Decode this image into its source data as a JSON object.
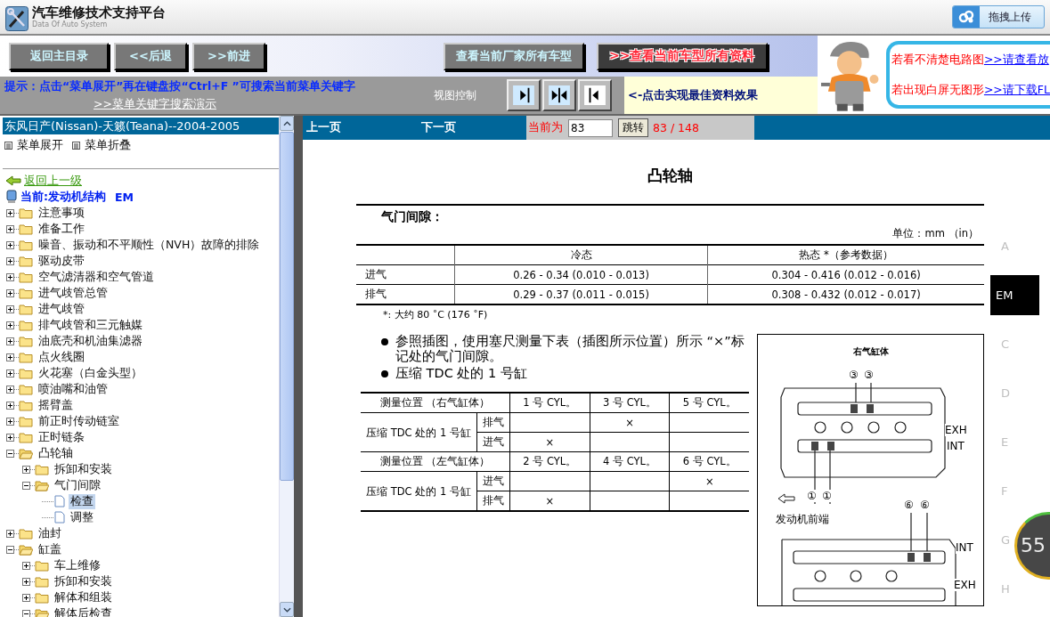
{
  "header": {
    "title": "汽车维修技术支持平台",
    "subtitle": "Data Of Auto System",
    "upload_button": "拖拽上传"
  },
  "toolbar": {
    "buttons": [
      {
        "label": "返回主目录",
        "kind": "plain"
      },
      {
        "label": "<<后退",
        "kind": "plain"
      },
      {
        "label": ">>前进",
        "kind": "plain"
      }
    ],
    "model_buttons": [
      {
        "label": "查看当前厂家所有车型",
        "kind": "plain"
      },
      {
        "label": ">>查看当前车型所有资料",
        "kind": "accent"
      }
    ]
  },
  "hint": {
    "text": "提示：点击“菜单展开”再在键盘按“Ctrl+F ”可搜索当前菜单关键字",
    "link": ">>菜单关键字搜索演示"
  },
  "view_control": {
    "label": "视图控制",
    "tip": "<-点击实现最佳资料效果"
  },
  "notice": {
    "lines": [
      {
        "text": "若看不清楚电路图",
        "link": ">>请查看放"
      },
      {
        "text": "若出现白屏无图形",
        "link": ">>请下载FL"
      }
    ]
  },
  "sidebar": {
    "vehicle": "东风日产(Nissan)-天籁(Teana)--2004-2005",
    "expand_all": "菜单展开",
    "collapse_all": "菜单折叠",
    "back_link": "返回上一级",
    "current": "当前:发动机结构",
    "current_code": "EM",
    "tree": [
      {
        "label": "注意事项",
        "kind": "folder",
        "expanded": false,
        "selected": false
      },
      {
        "label": "准备工作",
        "kind": "folder",
        "expanded": false,
        "selected": false
      },
      {
        "label": "噪音、振动和不平顺性（NVH）故障的排除",
        "kind": "folder",
        "expanded": false,
        "selected": false
      },
      {
        "label": "驱动皮带",
        "kind": "folder",
        "expanded": false,
        "selected": false
      },
      {
        "label": "空气滤清器和空气管道",
        "kind": "folder",
        "expanded": false,
        "selected": false
      },
      {
        "label": "进气歧管总管",
        "kind": "folder",
        "expanded": false,
        "selected": false
      },
      {
        "label": "进气歧管",
        "kind": "folder",
        "expanded": false,
        "selected": false
      },
      {
        "label": "排气歧管和三元触媒",
        "kind": "folder",
        "expanded": false,
        "selected": false
      },
      {
        "label": "油底壳和机油集滤器",
        "kind": "folder",
        "expanded": false,
        "selected": false
      },
      {
        "label": "点火线圈",
        "kind": "folder",
        "expanded": false,
        "selected": false
      },
      {
        "label": "火花塞（白金头型）",
        "kind": "folder",
        "expanded": false,
        "selected": false
      },
      {
        "label": "喷油嘴和油管",
        "kind": "folder",
        "expanded": false,
        "selected": false
      },
      {
        "label": "摇臂盖",
        "kind": "folder",
        "expanded": false,
        "selected": false
      },
      {
        "label": "前正时传动链室",
        "kind": "folder",
        "expanded": false,
        "selected": false
      },
      {
        "label": "正时链条",
        "kind": "folder",
        "expanded": false,
        "selected": false
      },
      {
        "label": "凸轮轴",
        "kind": "folder",
        "expanded": true,
        "selected": false,
        "children": [
          {
            "label": "拆卸和安装",
            "kind": "folder",
            "expanded": false,
            "selected": false
          },
          {
            "label": "气门间隙",
            "kind": "folder",
            "expanded": true,
            "selected": false,
            "children": [
              {
                "label": "检查",
                "kind": "page",
                "selected": true
              },
              {
                "label": "调整",
                "kind": "page",
                "selected": false
              }
            ]
          }
        ]
      },
      {
        "label": "油封",
        "kind": "folder",
        "expanded": false,
        "selected": false
      },
      {
        "label": "缸盖",
        "kind": "folder",
        "expanded": true,
        "selected": false,
        "children": [
          {
            "label": "车上维修",
            "kind": "folder",
            "expanded": false,
            "selected": false
          },
          {
            "label": "拆卸和安装",
            "kind": "folder",
            "expanded": false,
            "selected": false
          },
          {
            "label": "解体和组装",
            "kind": "folder",
            "expanded": false,
            "selected": false
          },
          {
            "label": "解体后检查",
            "kind": "folder",
            "expanded": true,
            "selected": false
          }
        ]
      }
    ]
  },
  "pager": {
    "prev": "上一页",
    "next": "下一页",
    "current_label": "当前为",
    "page_input": "83",
    "go_button": "跳转",
    "page_count": "83 / 148"
  },
  "document": {
    "title": "凸轮轴",
    "section": "气门间隙：",
    "unit": "单位：mm （in）",
    "clearance_table": {
      "columns": [
        "冷态",
        "热态 *（参考数据）"
      ],
      "rows": [
        {
          "valve": "进气",
          "cells": [
            "0.26 - 0.34 (0.010 - 0.013)",
            "0.304 - 0.416 (0.012 - 0.016)"
          ]
        },
        {
          "valve": "排气",
          "cells": [
            "0.29 - 0.37 (0.011 - 0.015)",
            "0.308 - 0.432 (0.012 - 0.017)"
          ]
        }
      ]
    },
    "footnote": "*: 大约 80 ˚C (176 ˚F)",
    "bullets": [
      "参照插图，使用塞尺测量下表（插图所示位置）所示 “×”标记处的气门间隙。",
      "压缩 TDC 处的 1 号缸"
    ],
    "position_table": [
      {
        "header": "测量位置 （右气缸体）",
        "cylinders": [
          "1 号 CYL。",
          "3 号 CYL。",
          "5 号 CYL。"
        ],
        "condition": "压缩 TDC 处的 1 号缸",
        "rows": [
          {
            "valve": "排气",
            "marks": [
              {
                "kind": "empty"
              },
              {
                "kind": "mark",
                "text": "×"
              },
              {
                "kind": "empty"
              }
            ]
          },
          {
            "valve": "进气",
            "marks": [
              {
                "kind": "mark",
                "text": "×"
              },
              {
                "kind": "empty"
              },
              {
                "kind": "empty"
              }
            ]
          }
        ]
      },
      {
        "header": "测量位置 （左气缸体）",
        "cylinders": [
          "2 号 CYL。",
          "4 号 CYL。",
          "6 号 CYL。"
        ],
        "condition": "压缩 TDC 处的 1 号缸",
        "rows": [
          {
            "valve": "进气",
            "marks": [
              {
                "kind": "empty"
              },
              {
                "kind": "empty"
              },
              {
                "kind": "mark",
                "text": "×"
              }
            ]
          },
          {
            "valve": "排气",
            "marks": [
              {
                "kind": "mark",
                "text": "×"
              },
              {
                "kind": "empty"
              },
              {
                "kind": "empty"
              }
            ]
          }
        ]
      }
    ],
    "figure": {
      "title": "右气缸体",
      "callouts": [
        "③",
        "③",
        "EXH",
        "INT",
        "①",
        "①",
        "发动机前端",
        "⑥",
        "⑥",
        "INT",
        "EXH"
      ]
    }
  },
  "section_index": [
    {
      "label": "A",
      "selected": false
    },
    {
      "label": "EM",
      "selected": true
    },
    {
      "label": "C",
      "selected": false
    },
    {
      "label": "D",
      "selected": false
    },
    {
      "label": "E",
      "selected": false
    },
    {
      "label": "F",
      "selected": false
    },
    {
      "label": "G",
      "selected": false
    },
    {
      "label": "H",
      "selected": false
    }
  ],
  "overlay_badge": "55"
}
